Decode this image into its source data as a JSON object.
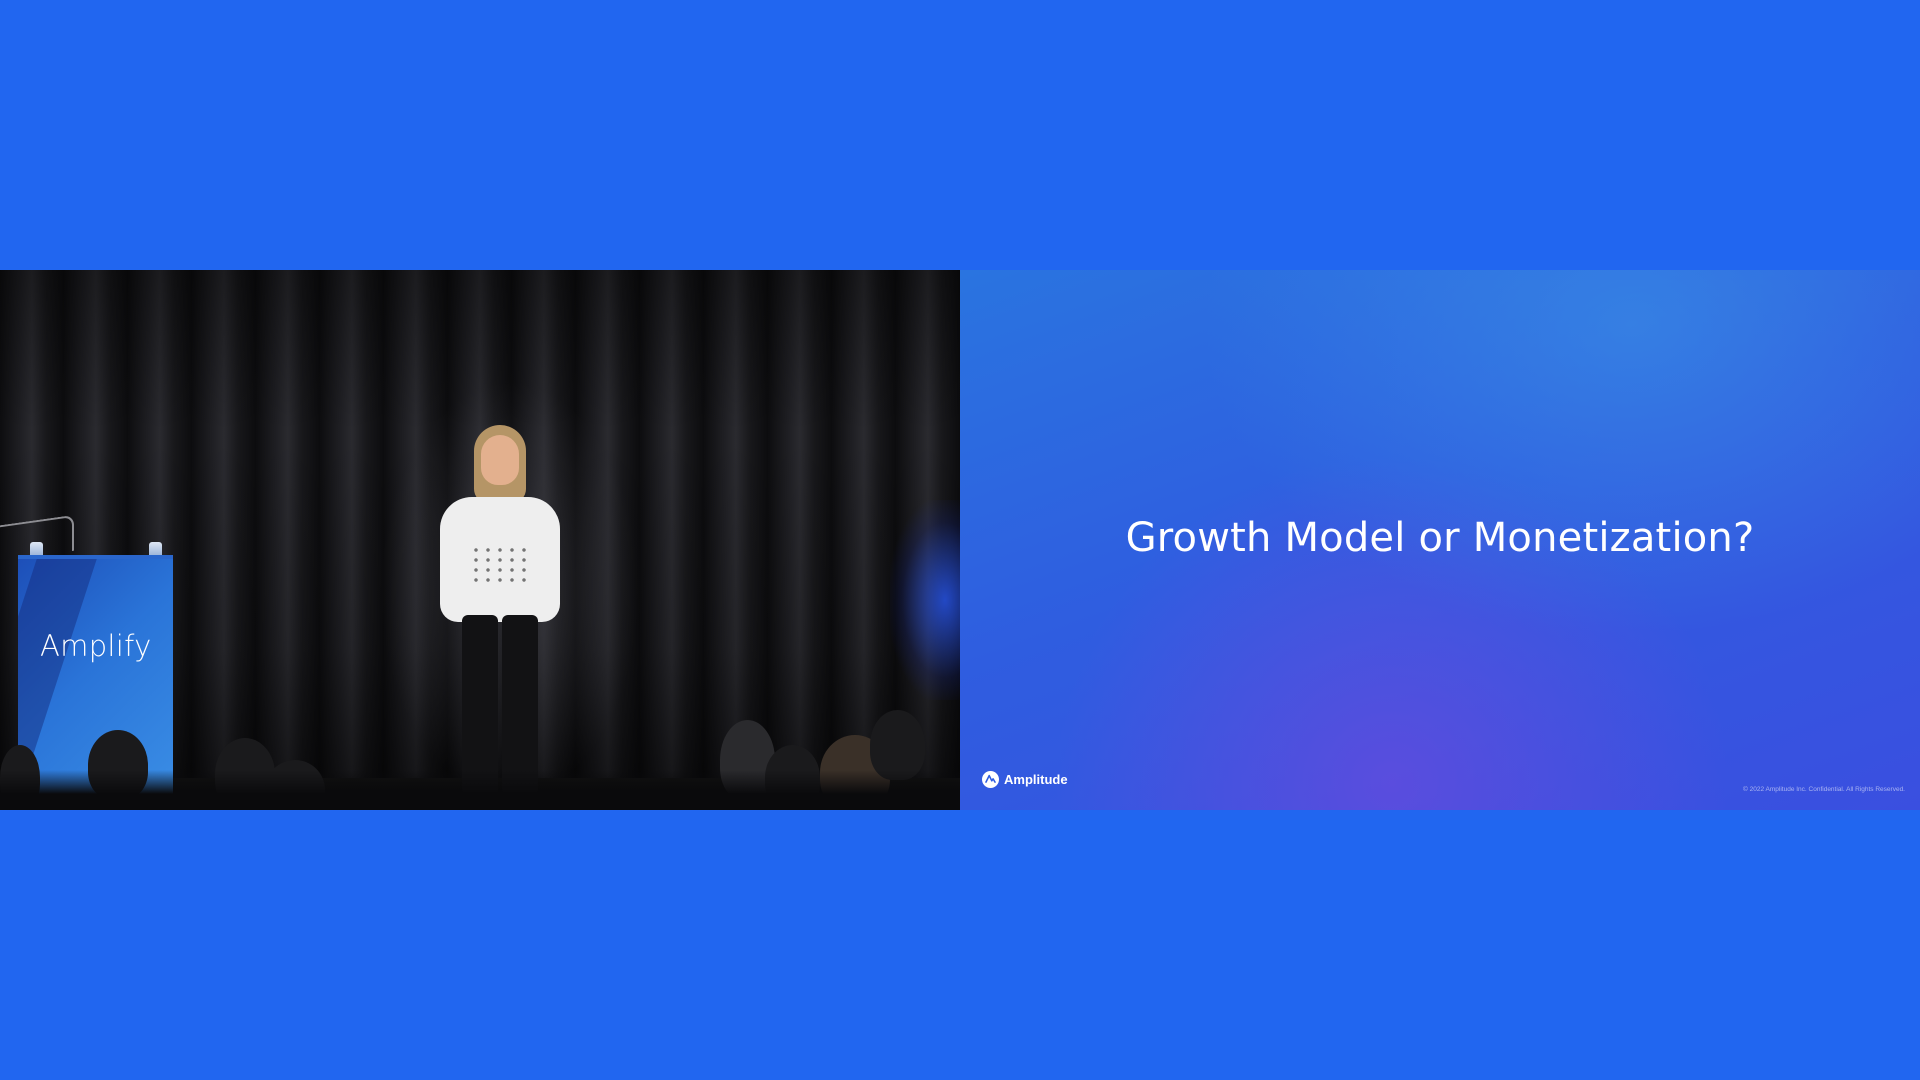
{
  "stage": {
    "podium_brand": "Amplify"
  },
  "slide": {
    "title": "Growth Model or Monetization?",
    "brand_name": "Amplitude",
    "brand_icon": "amplitude-logo-icon",
    "footer": "© 2022 Amplitude Inc.  Confidential.  All Rights Reserved."
  },
  "colors": {
    "background": "#2166f0",
    "slide_text": "#ffffff"
  }
}
